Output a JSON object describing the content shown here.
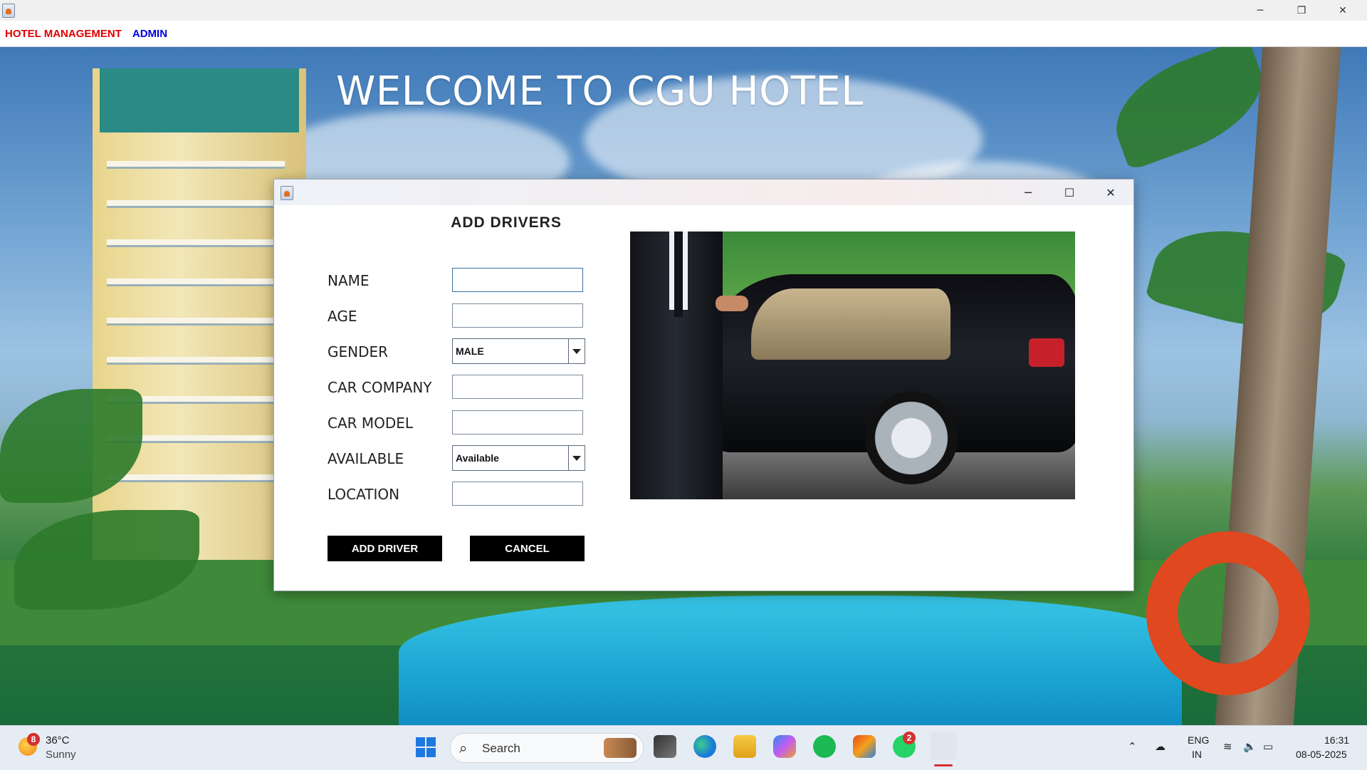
{
  "window": {
    "menu": [
      {
        "label": "HOTEL MANAGEMENT",
        "color": "#e00000"
      },
      {
        "label": "ADMIN",
        "color": "#0000e0"
      }
    ],
    "controls": {
      "minimize": "─",
      "maximize": "❐",
      "close": "✕"
    }
  },
  "background": {
    "welcome_text": "WELCOME TO CGU HOTEL"
  },
  "dialog": {
    "controls": {
      "minimize": "─",
      "maximize": "☐",
      "close": "✕"
    },
    "title": "ADD DRIVERS",
    "fields": {
      "name": {
        "label": "NAME",
        "value": ""
      },
      "age": {
        "label": "AGE",
        "value": ""
      },
      "gender": {
        "label": "GENDER",
        "selected": "MALE"
      },
      "car_company": {
        "label": "CAR COMPANY",
        "value": ""
      },
      "car_model": {
        "label": "CAR MODEL",
        "value": ""
      },
      "available": {
        "label": "AVAILABLE",
        "selected": "Available"
      },
      "location": {
        "label": "LOCATION",
        "value": ""
      }
    },
    "buttons": {
      "add": "ADD DRIVER",
      "cancel": "CANCEL"
    },
    "image": "chauffeur-opening-car-door-photo"
  },
  "taskbar": {
    "weather": {
      "temp": "36°C",
      "condition": "Sunny",
      "badge": "8"
    },
    "search_placeholder": "Search",
    "apps": [
      "start",
      "search",
      "task-view",
      "edge",
      "file-explorer",
      "copilot",
      "spotify",
      "office",
      "whatsapp",
      "java"
    ],
    "whatsapp_badge": "2",
    "tray": {
      "lang_top": "ENG",
      "lang_bottom": "IN",
      "time": "16:31",
      "date": "08-05-2025"
    }
  }
}
